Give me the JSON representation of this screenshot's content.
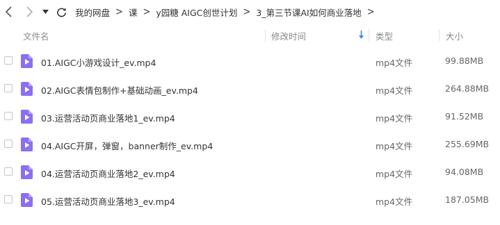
{
  "toolbar": {
    "back_icon": "chevron-left-icon",
    "forward_icon": "chevron-right-icon",
    "history_icon": "caret-down-icon",
    "refresh_icon": "refresh-icon",
    "breadcrumb": [
      "我的网盘",
      "课",
      "y园糖 AIGC创世计划",
      "3_第三节课AI如何商业落地"
    ]
  },
  "columns": {
    "name": "文件名",
    "modified": "修改时间",
    "type": "类型",
    "size": "大小"
  },
  "colors": {
    "icon_purple": "#8b6ff0",
    "sort_arrow": "#2f8cf0",
    "checkbox_border": "#c5c5c5"
  },
  "files": [
    {
      "name": "01.AIGC小游戏设计_ev.mp4",
      "type": "mp4文件",
      "size": "99.88MB",
      "icon": "video-file-icon"
    },
    {
      "name": "02.AIGC表情包制作+基础动画_ev.mp4",
      "type": "mp4文件",
      "size": "264.88MB",
      "icon": "video-file-icon"
    },
    {
      "name": "03.运营活动页商业落地1_ev.mp4",
      "type": "mp4文件",
      "size": "91.52MB",
      "icon": "video-file-icon"
    },
    {
      "name": "04.AIGC开屏，弹窗，banner制作_ev.mp4",
      "type": "mp4文件",
      "size": "255.69MB",
      "icon": "video-file-icon"
    },
    {
      "name": "04.运营活动页商业落地2_ev.mp4",
      "type": "mp4文件",
      "size": "94.08MB",
      "icon": "video-file-icon"
    },
    {
      "name": "05.运营活动页商业落地3_ev.mp4",
      "type": "mp4文件",
      "size": "187.05MB",
      "icon": "video-file-icon"
    }
  ]
}
